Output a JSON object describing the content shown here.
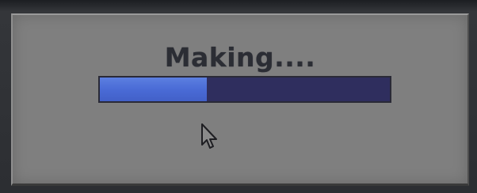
{
  "dialog": {
    "title": "Making....",
    "progress": {
      "fraction": 0.37,
      "fill_color": "#4a6bd6",
      "track_color": "#2f2e5e"
    }
  },
  "cursor": {
    "icon": "arrow-pointer-icon"
  }
}
